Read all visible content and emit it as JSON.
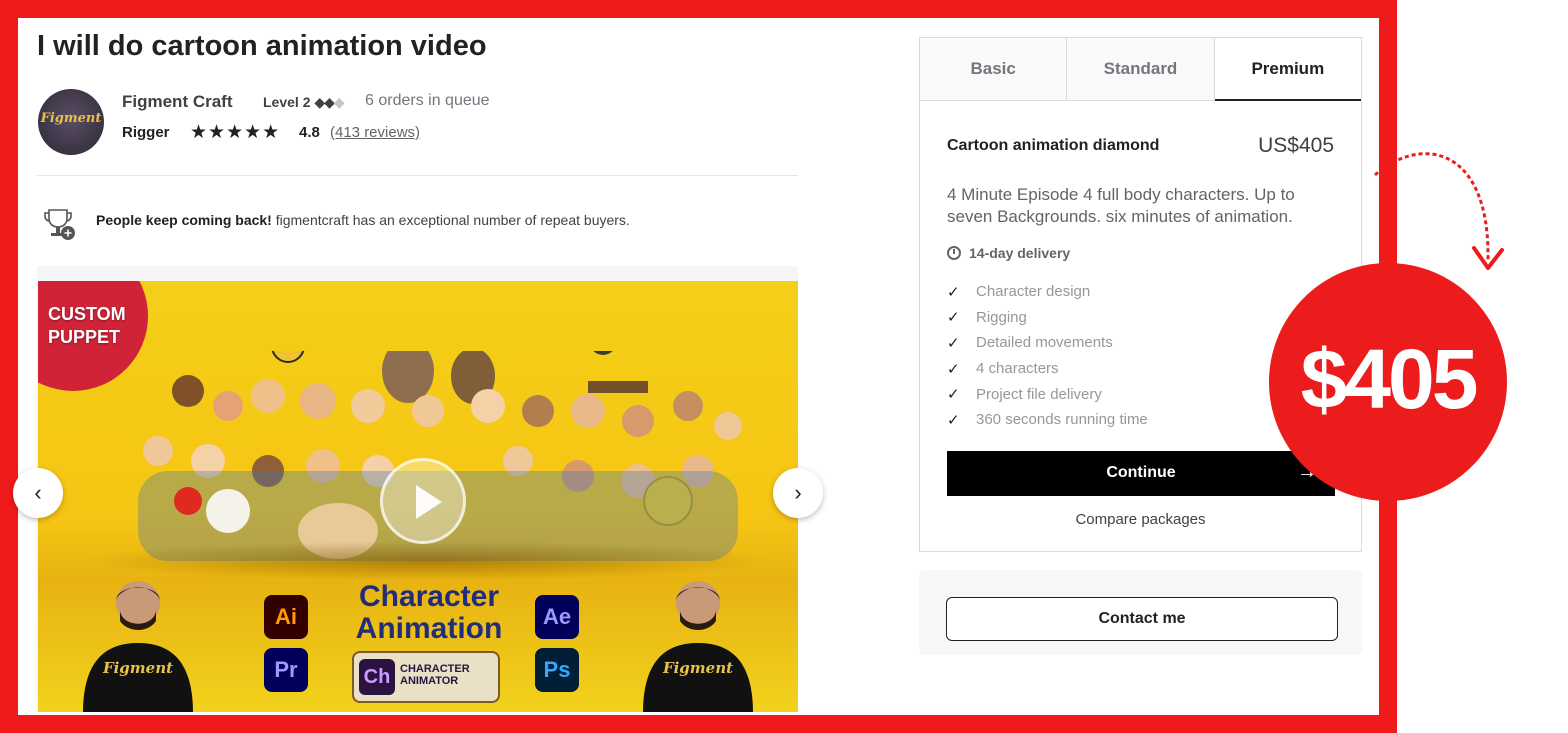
{
  "gig": {
    "title": "I will do cartoon animation video",
    "seller": {
      "name": "Figment Craft",
      "level": "Level 2",
      "queue": "6 orders in queue",
      "role": "Rigger",
      "stars": "★★★★★",
      "rating": "4.8",
      "reviews": "(413 reviews)",
      "avatar_text": "Figment"
    },
    "repeat_buyers": {
      "bold": "People keep coming back!",
      "text": " figmentcraft has an exceptional number of repeat buyers."
    }
  },
  "gallery": {
    "badge_line1": "CUSTOM",
    "badge_line2": "PUPPET",
    "headline_line1": "Character",
    "headline_line2": "Animation",
    "apps": {
      "ai": "Ai",
      "pr": "Pr",
      "ae": "Ae",
      "ps": "Ps",
      "ch": "Ch",
      "ch_line1": "CHARACTER",
      "ch_line2": "ANIMATOR"
    },
    "shirt_text": "Figment",
    "prev_arrow": "‹",
    "next_arrow": "›"
  },
  "packages": {
    "tabs": [
      "Basic",
      "Standard",
      "Premium"
    ],
    "active_tab": "Premium",
    "name": "Cartoon animation diamond",
    "price": "US$405",
    "description": "4 Minute Episode 4 full body characters. Up to seven Backgrounds. six minutes of animation.",
    "delivery": "14-day delivery",
    "features": [
      "Character design",
      "Rigging",
      "Detailed movements",
      "4 characters",
      "Project file delivery",
      "360 seconds running time"
    ],
    "continue_label": "Continue",
    "continue_arrow": "→",
    "compare_label": "Compare packages"
  },
  "contact": {
    "label": "Contact me"
  },
  "callout": {
    "price": "$405"
  },
  "colors": {
    "frame_red": "#f01a1a",
    "callout_red": "#ec1c1c",
    "gallery_yellow": "#f4cf18",
    "badge_red": "#d12338",
    "headline_blue": "#1f2d7a"
  }
}
